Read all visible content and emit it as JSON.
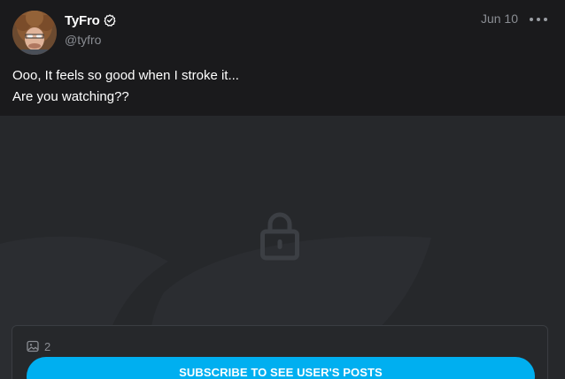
{
  "post": {
    "author": {
      "display_name": "TyFro",
      "handle": "@tyfro",
      "verified": true
    },
    "date": "Jun 10",
    "text_lines": [
      "Ooo, It feels so good when I stroke it...",
      "Are you watching??"
    ]
  },
  "locked_media": {
    "icon": "lock-icon",
    "image_count": "2",
    "count_icon": "image-icon",
    "subscribe_label": "SUBSCRIBE TO SEE USER'S POSTS"
  },
  "colors": {
    "background": "#1a1a1c",
    "locked_background": "#26282b",
    "accent": "#00aff0",
    "muted_text": "#8a8d93"
  }
}
